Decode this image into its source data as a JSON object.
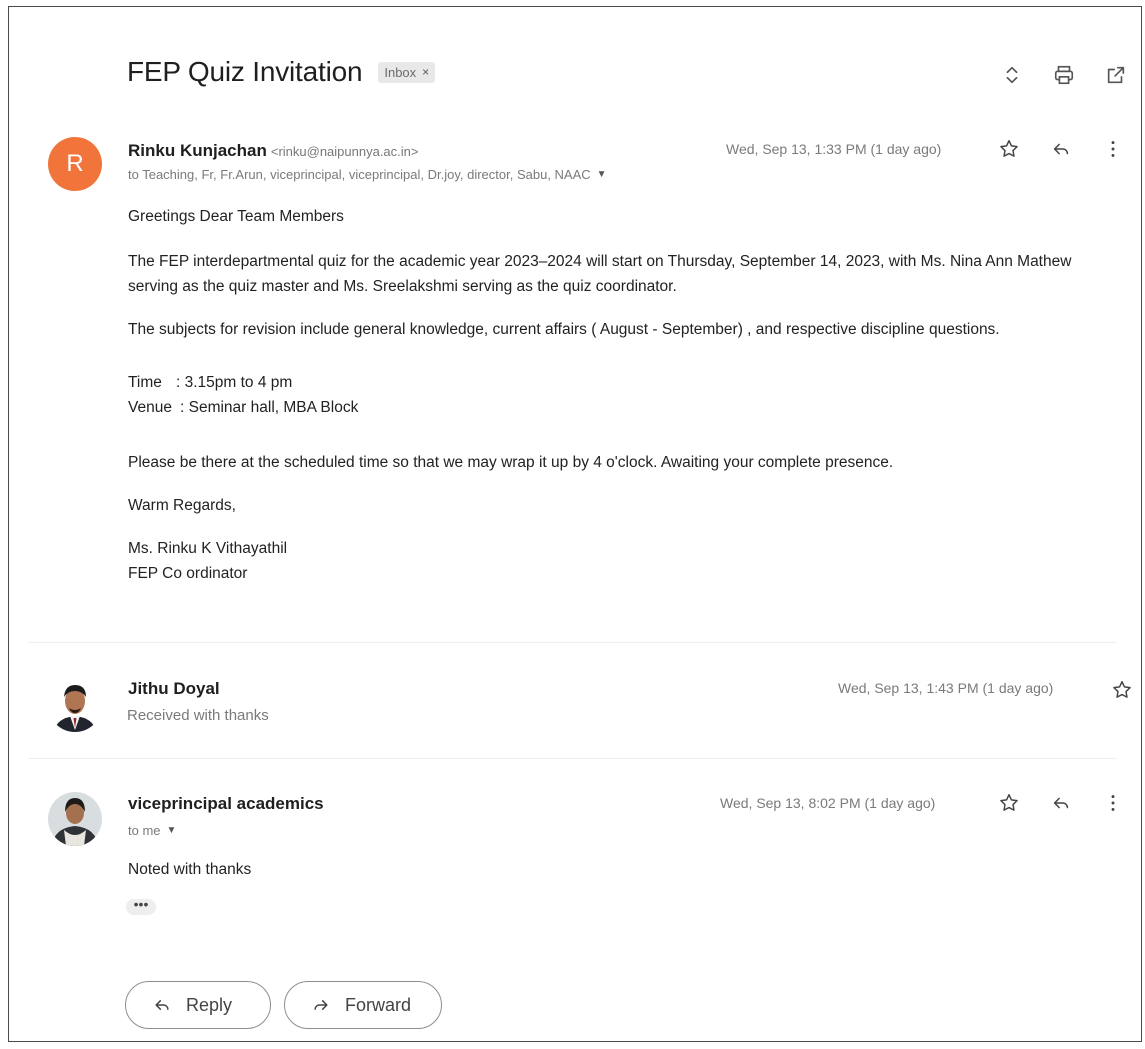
{
  "subject": "FEP Quiz Invitation",
  "label_badge": "Inbox",
  "label_close": "×",
  "messages": [
    {
      "avatar_letter": "R",
      "avatar_color": "#f1753a",
      "sender": "Rinku Kunjachan",
      "email": "<rinku@naipunnya.ac.in>",
      "recipients": "to Teaching, Fr, Fr.Arun, viceprincipal, viceprincipal, Dr.joy, director, Sabu, NAAC",
      "timestamp": "Wed, Sep 13, 1:33 PM (1 day ago)",
      "body": {
        "greeting": "Greetings Dear Team Members",
        "para1": "The FEP interdepartmental quiz for the academic year 2023–2024 will start on Thursday, September 14, 2023, with Ms. Nina Ann Mathew serving as the quiz master and Ms. Sreelakshmi serving as the quiz coordinator.",
        "para2": "The subjects for revision include general knowledge, current affairs ( August - September) , and respective discipline questions.",
        "time_label": "Time",
        "time_value": ": 3.15pm to 4 pm",
        "venue_label": "Venue",
        "venue_value": ": Seminar hall, MBA Block",
        "para3": "Please be there at the scheduled time so that we may wrap it up by 4 o'clock. Awaiting your complete presence.",
        "closing": "Warm Regards,",
        "signature_name": "Ms. Rinku K Vithayathil",
        "signature_title": "FEP Co ordinator"
      }
    },
    {
      "sender": "Jithu Doyal",
      "snippet": "Received with thanks",
      "timestamp": "Wed, Sep 13, 1:43 PM (1 day ago)"
    },
    {
      "sender": "viceprincipal academics",
      "recipients": "to me",
      "timestamp": "Wed, Sep 13, 8:02 PM (1 day ago)",
      "body": "Noted with thanks",
      "ellipsis": "•••"
    }
  ],
  "actions": {
    "reply": "Reply",
    "forward": "Forward"
  }
}
